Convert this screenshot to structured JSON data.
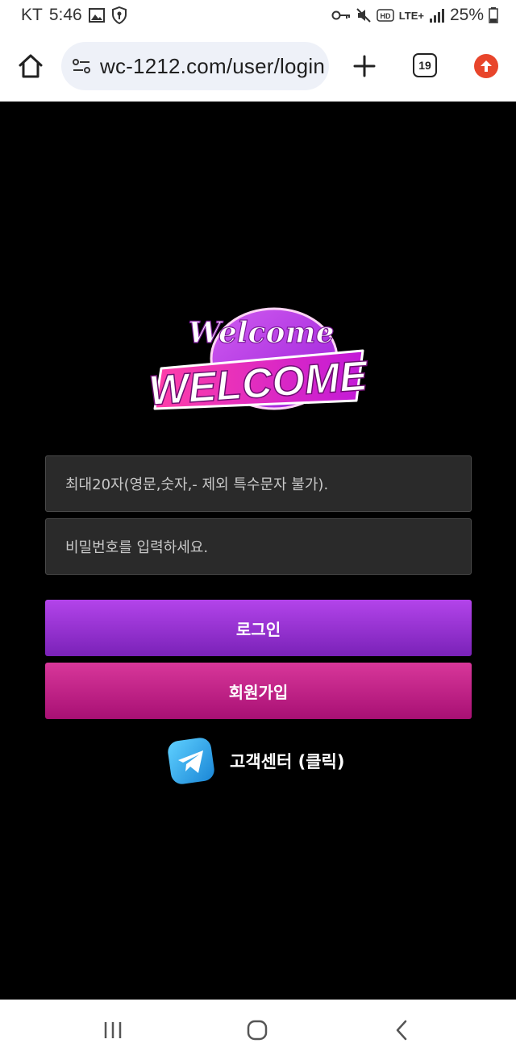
{
  "status_bar": {
    "carrier": "KT",
    "time": "5:46",
    "network": "LTE+",
    "battery": "25%",
    "icons": [
      "gallery-icon",
      "shield-icon",
      "key-icon",
      "mute-icon",
      "hd-icon",
      "signal-icon",
      "battery-icon"
    ]
  },
  "browser": {
    "url": "wc-1212.com/user/login",
    "tab_count": "19"
  },
  "logo": {
    "script": "Welcome",
    "main": "WELCOME"
  },
  "form": {
    "username_placeholder": "최대20자(영문,숫자,- 제외 특수문자 불가).",
    "password_placeholder": "비밀번호를 입력하세요.",
    "login_label": "로그인",
    "signup_label": "회원가입"
  },
  "support": {
    "label": "고객센터 (클릭)",
    "icon": "telegram-icon"
  },
  "colors": {
    "login": "#9c37d6",
    "signup": "#c8248a",
    "field_bg": "#2a2a2a",
    "page_bg": "#000000"
  }
}
